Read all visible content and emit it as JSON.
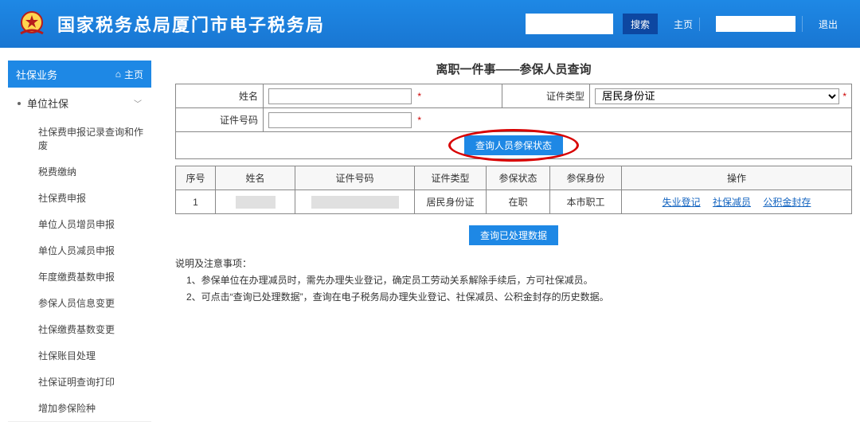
{
  "header": {
    "site_title": "国家税务总局厦门市电子税务局",
    "search_placeholder": "",
    "search_btn": "搜索",
    "home_link": "主页",
    "user_name": "",
    "logout": "退出"
  },
  "sidebar": {
    "section_title": "社保业务",
    "home_label": "主页",
    "parent": "单位社保",
    "items": [
      "社保费申报记录查询和作废",
      "税费缴纳",
      "社保费申报",
      "单位人员增员申报",
      "单位人员减员申报",
      "年度缴费基数申报",
      "参保人员信息变更",
      "社保缴费基数变更",
      "社保账目处理",
      "社保证明查询打印",
      "增加参保险种"
    ]
  },
  "main": {
    "title": "离职一件事——参保人员查询",
    "form": {
      "name_label": "姓名",
      "name_value": "",
      "cert_type_label": "证件类型",
      "cert_type_value": "居民身份证",
      "cert_no_label": "证件号码",
      "cert_no_value": ""
    },
    "query_btn": "查询人员参保状态",
    "table": {
      "headers": [
        "序号",
        "姓名",
        "证件号码",
        "证件类型",
        "参保状态",
        "参保身份",
        "操作"
      ],
      "rows": [
        {
          "seq": "1",
          "name": "",
          "cert_no": "",
          "cert_type": "居民身份证",
          "status": "在职",
          "identity": "本市职工",
          "ops": [
            "失业登记",
            "社保减员",
            "公积金封存"
          ]
        }
      ]
    },
    "processed_btn": "查询已处理数据",
    "notes_title": "说明及注意事项：",
    "notes": [
      "1、参保单位在办理减员时，需先办理失业登记，确定员工劳动关系解除手续后，方可社保减员。",
      "2、可点击“查询已处理数据”，查询在电子税务局办理失业登记、社保减员、公积金封存的历史数据。"
    ]
  }
}
